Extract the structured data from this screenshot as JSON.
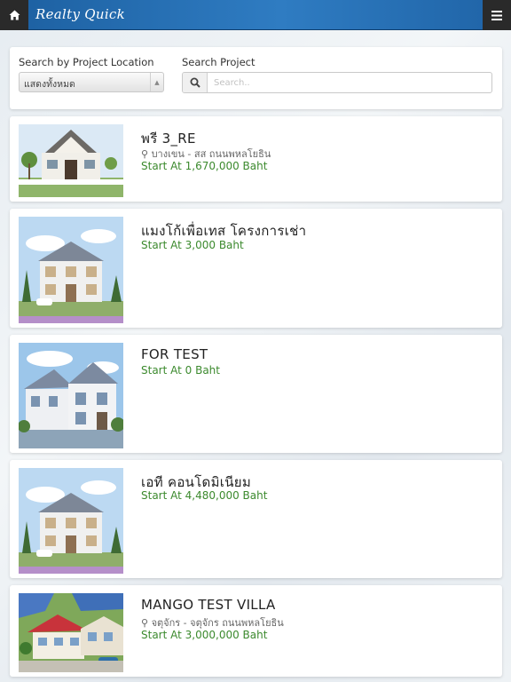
{
  "header": {
    "title": "Realty Quick",
    "home_icon": "home-icon",
    "menu_icon": "menu-icon",
    "bar_color": "#2f7cc2"
  },
  "search": {
    "location_label": "Search by Project Location",
    "location_selected": "แสดงทั้งหมด",
    "project_label": "Search Project",
    "project_placeholder": "Search..",
    "project_value": ""
  },
  "projects": [
    {
      "name": "พรี 3_RE",
      "location": "บางเขน - สส ถนนพหลโยธิน",
      "price": "Start At 1,670,000 Baht"
    },
    {
      "name": "แมงโก้เพื่อเทส โครงการเช่า",
      "location": "",
      "price": "Start At 3,000 Baht"
    },
    {
      "name": "FOR TEST",
      "location": "",
      "price": "Start At 0 Baht"
    },
    {
      "name": "เอที คอนโดมิเนียม",
      "location": "",
      "price": "Start At 4,480,000 Baht"
    },
    {
      "name": "MANGO TEST VILLA",
      "location": "จตุจักร - จตุจักร ถนนพหลโยธิน",
      "price": "Start At 3,000,000 Baht"
    }
  ],
  "colors": {
    "price": "#3c8a2e",
    "accent": "#2f7cc2"
  }
}
